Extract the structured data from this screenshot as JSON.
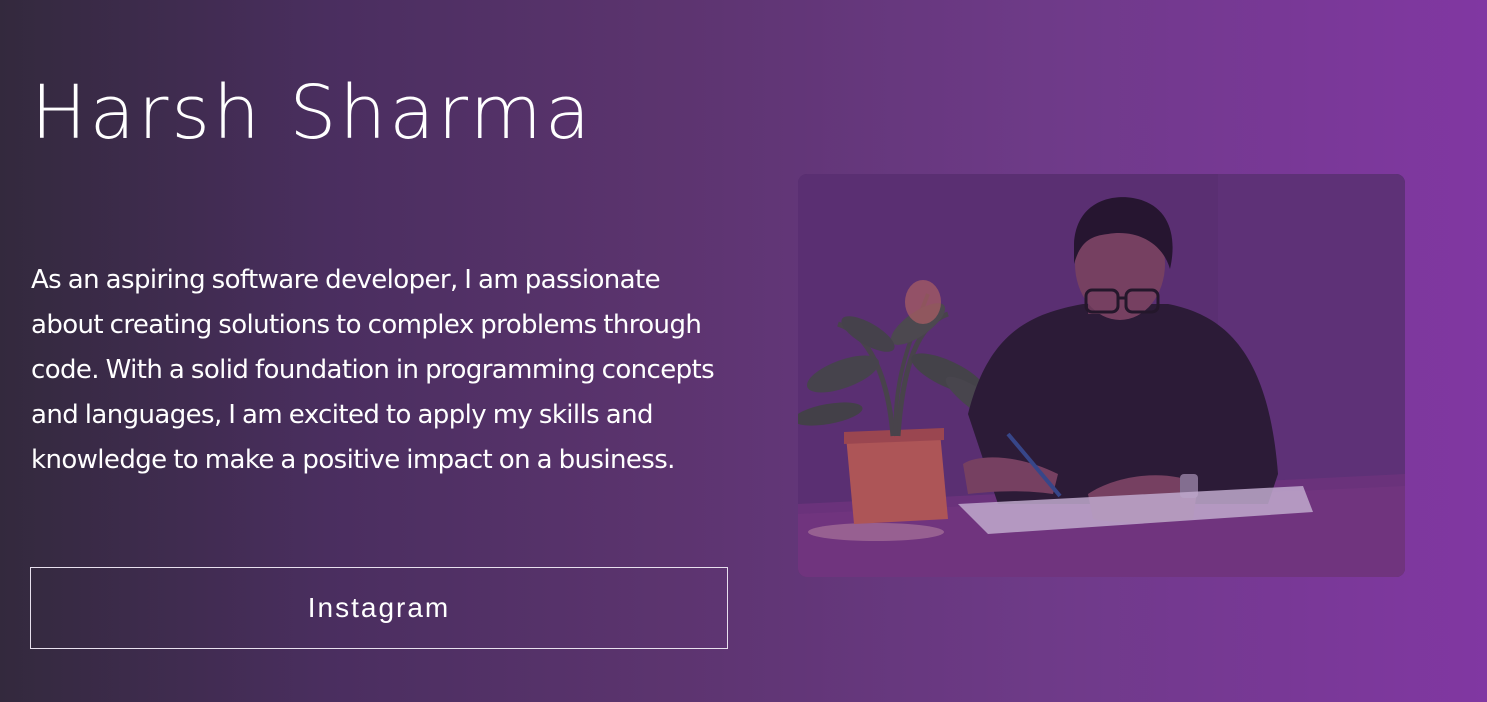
{
  "hero": {
    "title": "Harsh Sharma",
    "bio": "As an aspiring software developer, I am passionate about creating solutions to complex problems through code. With a solid foundation in programming concepts and languages, I am excited to apply my skills and knowledge to make a positive impact on a business.",
    "button_label": "Instagram"
  },
  "photo": {
    "subject": "portrait-photo"
  },
  "colors": {
    "gradient_start": "#33293d",
    "gradient_end": "#8137a2",
    "text": "#ffffff"
  }
}
